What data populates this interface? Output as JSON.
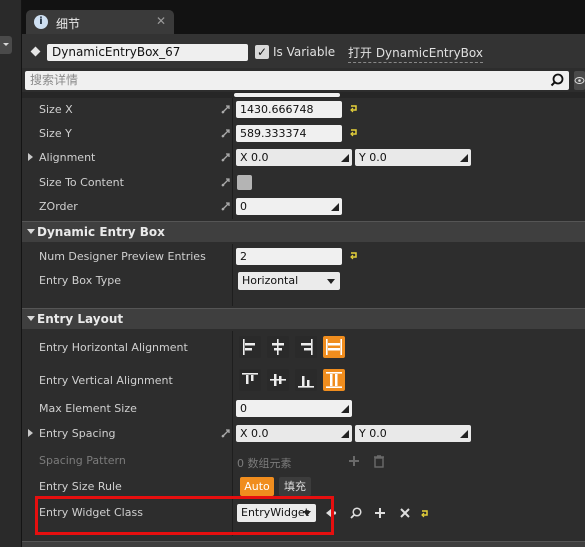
{
  "tab": {
    "title": "细节",
    "info_icon": "info-icon",
    "close_icon": "close-icon"
  },
  "header": {
    "name_value": "DynamicEntryBox_67",
    "is_variable_label": "Is Variable",
    "is_variable_checked": true,
    "open_link": "打开 DynamicEntryBox"
  },
  "search": {
    "placeholder": "搜索详情"
  },
  "rows_top": {
    "size_x": {
      "label": "Size X",
      "value": "1430.666748"
    },
    "size_y": {
      "label": "Size Y",
      "value": "589.333374"
    },
    "alignment": {
      "label": "Alignment",
      "x": "X  0.0",
      "y": "Y  0.0"
    },
    "size_to_content": {
      "label": "Size To Content"
    },
    "zorder": {
      "label": "ZOrder",
      "value": "0"
    }
  },
  "dynamic_entry_box": {
    "title": "Dynamic Entry Box",
    "num_preview": {
      "label": "Num Designer Preview Entries",
      "value": "2"
    },
    "entry_box_type": {
      "label": "Entry Box Type",
      "value": "Horizontal"
    }
  },
  "entry_layout": {
    "title": "Entry Layout",
    "h_align": {
      "label": "Entry Horizontal Alignment",
      "active_index": 3
    },
    "v_align": {
      "label": "Entry Vertical Alignment",
      "active_index": 3
    },
    "max_element_size": {
      "label": "Max Element Size",
      "value": "0"
    },
    "entry_spacing": {
      "label": "Entry Spacing",
      "x": "X  0.0",
      "y": "Y  0.0"
    },
    "spacing_pattern": {
      "label": "Spacing Pattern",
      "value": "0 数组元素"
    },
    "entry_size_rule": {
      "label": "Entry Size Rule",
      "auto": "Auto",
      "fill": "填充",
      "selected": "Auto"
    },
    "entry_widget_class": {
      "label": "Entry Widget Class",
      "value": "EntryWidget"
    }
  },
  "colors": {
    "accent": "#f08d1e",
    "highlight": "#e60f0f",
    "panel": "#2d2d2d"
  }
}
